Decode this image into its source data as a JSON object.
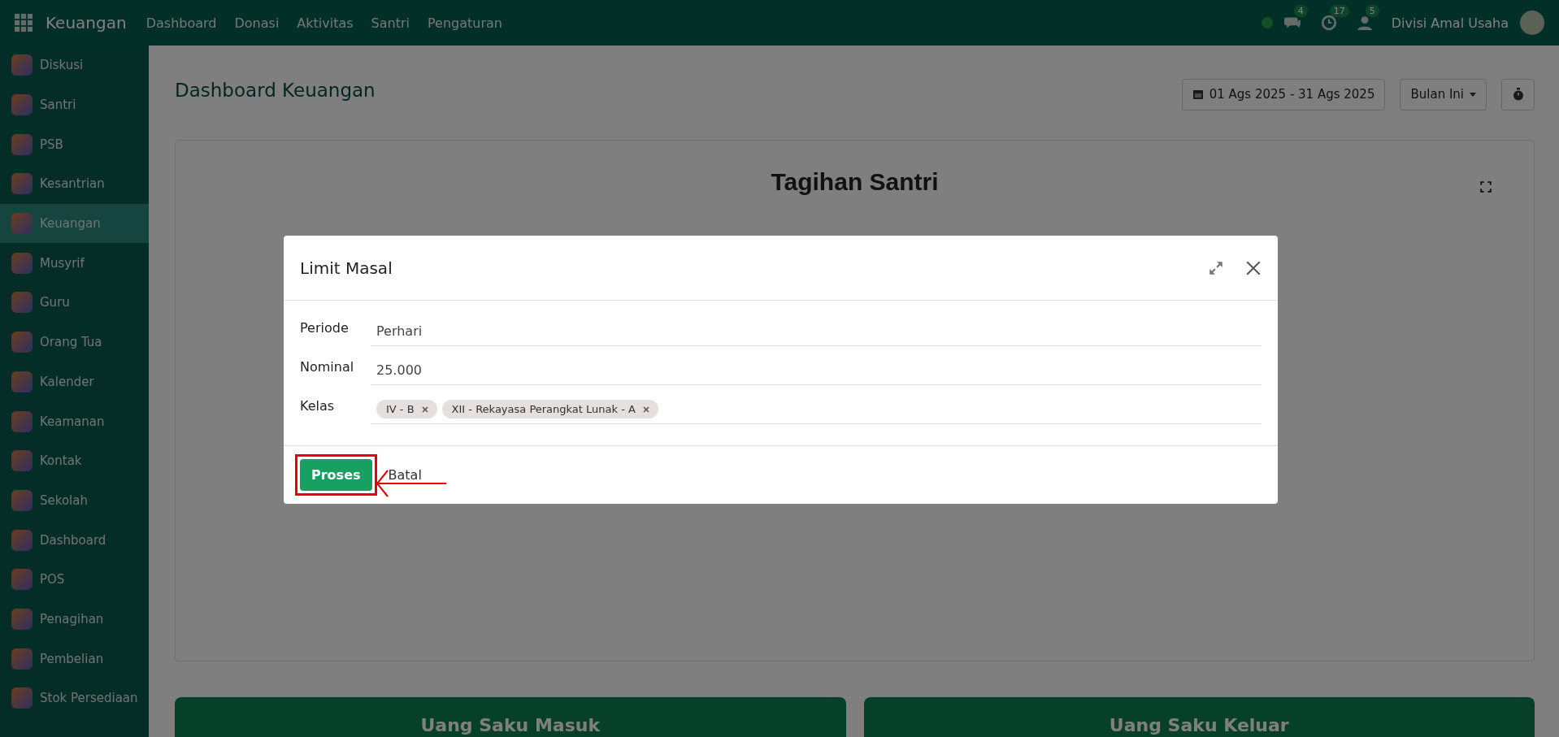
{
  "topbar": {
    "app_name": "Keuangan",
    "menu": [
      "Dashboard",
      "Donasi",
      "Aktivitas",
      "Santri",
      "Pengaturan"
    ],
    "status_online": true,
    "badges": [
      {
        "kind": "chat",
        "count": "4"
      },
      {
        "kind": "activity",
        "count": "17"
      },
      {
        "kind": "user",
        "count": "5"
      }
    ],
    "company": "Divisi Amal Usaha"
  },
  "sidebar": {
    "items": [
      {
        "label": "Diskusi",
        "selected": false
      },
      {
        "label": "Santri",
        "selected": false
      },
      {
        "label": "PSB",
        "selected": false
      },
      {
        "label": "Kesantrian",
        "selected": false
      },
      {
        "label": "Keuangan",
        "selected": true
      },
      {
        "label": "Musyrif",
        "selected": false
      },
      {
        "label": "Guru",
        "selected": false
      },
      {
        "label": "Orang Tua",
        "selected": false
      },
      {
        "label": "Kalender",
        "selected": false
      },
      {
        "label": "Keamanan",
        "selected": false
      },
      {
        "label": "Kontak",
        "selected": false
      },
      {
        "label": "Sekolah",
        "selected": false
      },
      {
        "label": "Dashboard",
        "selected": false
      },
      {
        "label": "POS",
        "selected": false
      },
      {
        "label": "Penagihan",
        "selected": false
      },
      {
        "label": "Pembelian",
        "selected": false
      },
      {
        "label": "Stok Persediaan",
        "selected": false
      }
    ]
  },
  "page": {
    "title": "Dashboard Keuangan",
    "date_range": "01 Ags 2025 - 31 Ags 2025",
    "period_button": "Bulan Ini",
    "chart_card_title": "Tagihan Santri",
    "cards": [
      "Uang Saku Masuk",
      "Uang Saku Keluar"
    ]
  },
  "dialog": {
    "title": "Limit Masal",
    "fields": [
      {
        "kind": "text",
        "label": "Periode",
        "value": "Perhari"
      },
      {
        "kind": "text",
        "label": "Nominal",
        "value": "25.000"
      },
      {
        "kind": "tags",
        "label": "Kelas",
        "tags": [
          "IV - B",
          "XII - Rekayasa Perangkat Lunak - A"
        ]
      }
    ],
    "buttons": [
      {
        "label": "Proses",
        "highlighted": true
      },
      {
        "label": "Batal",
        "highlighted": false
      }
    ]
  }
}
